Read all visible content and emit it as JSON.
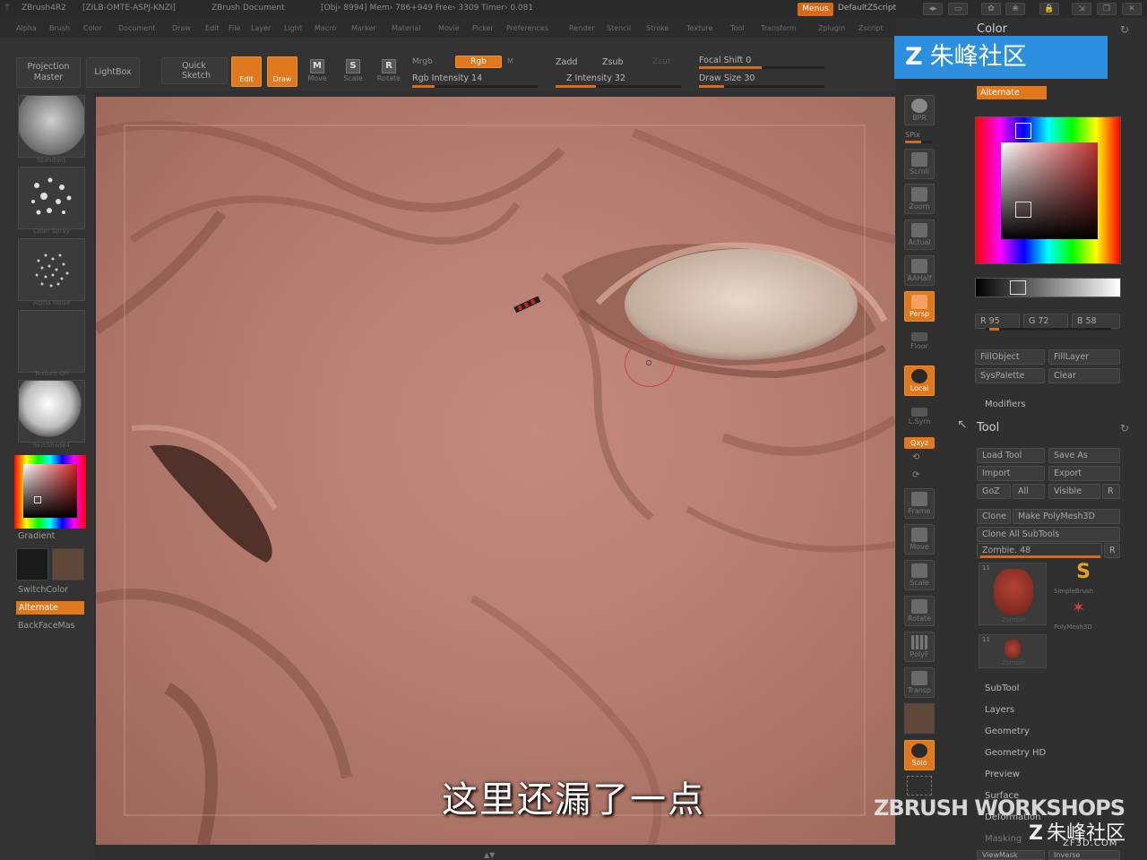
{
  "titlebar": {
    "app": "ZBrush4R2",
    "build": "[ZILB-OMTE-ASPJ-KNZI]",
    "doc": "ZBrush Document",
    "stats": "[Obj› 8994] Mem› 786+949 Free› 3309 Timer› 0.081",
    "menus_btn": "Menus",
    "script": "DefaultZScript"
  },
  "menubar": [
    "Alpha",
    "Brush",
    "Color",
    "Document",
    "Draw",
    "Edit",
    "File",
    "Layer",
    "Light",
    "Macro",
    "Marker",
    "Material",
    "Movie",
    "Picker",
    "Preferences",
    "Render",
    "Stencil",
    "Stroke",
    "Texture",
    "Tool",
    "Transform",
    "Zplugin",
    "Zscript"
  ],
  "shelf": {
    "projection_master": "Projection Master",
    "lightbox": "LightBox",
    "quick_sketch": "Quick Sketch",
    "edit": "Edit",
    "draw": "Draw",
    "move": "Move",
    "scale": "Scale",
    "rotate": "Rotate",
    "mrgb": "Mrgb",
    "rgb": "Rgb",
    "m": "M",
    "zadd": "Zadd",
    "zsub": "Zsub",
    "zcut": "Zcut",
    "rgb_intensity": "Rgb Intensity 14",
    "z_intensity": "Z Intensity 32",
    "focal_shift": "Focal Shift 0",
    "draw_size": "Draw Size 30"
  },
  "left_panel": {
    "captions": [
      "Standard",
      "Color Spray",
      "Alpha Noise",
      "Texture Off",
      "SkinShade4"
    ],
    "gradient": "Gradient",
    "switchcolor": "SwitchColor",
    "alternate": "Alternate",
    "backfacemask": "BackFaceMas"
  },
  "right_toolbar": [
    "BPR",
    "SPix",
    "Scroll",
    "Zoom",
    "Actual",
    "AAHalf",
    "Persp",
    "Floor",
    "Local",
    "L.Sym",
    "Qxyz",
    "Frame",
    "Move",
    "Scale",
    "Rotate",
    "PolyF",
    "Transp",
    "Solo"
  ],
  "color_panel": {
    "title": "Color",
    "alternate": "Alternate",
    "r": "R 95",
    "g": "G 72",
    "b": "B 58",
    "fill_object": "FillObject",
    "fill_layer": "FillLayer",
    "syspalette": "SysPalette",
    "clear": "Clear",
    "modifiers": "Modifiers"
  },
  "tool_panel": {
    "title": "Tool",
    "load_tool": "Load Tool",
    "save_as": "Save As",
    "import": "Import",
    "export": "Export",
    "goz": "GoZ",
    "all": "All",
    "visible": "Visible",
    "r": "R",
    "clone": "Clone",
    "make_polymesh": "Make PolyMesh3D",
    "clone_all": "Clone All SubTools",
    "current_tool": "Zombie. 48",
    "thumb_count_1": "11",
    "thumb_count_2": "11",
    "thumb_label_1": "Zombie",
    "thumb_label_2": "Zombie",
    "simplebrush": "SimpleBrush",
    "polymesh3d": "PolyMesh3D",
    "sections": [
      "SubTool",
      "Layers",
      "Geometry",
      "Geometry HD",
      "Preview",
      "Surface",
      "Deformation",
      "Masking"
    ],
    "bottom_left": "ViewMask",
    "bottom_right": "Inverse"
  },
  "subtitle": "这里还漏了一点",
  "watermark": "朱峰社区",
  "brand": "ZBRUSH WORKSHOPS",
  "brand_cn": "朱峰社区",
  "brand_url": "ZF3D.COM",
  "colors": {
    "accent": "#e0781e",
    "skin": "#b67d70",
    "panel": "#303030",
    "watermark_blue": "#2d8fe0"
  }
}
